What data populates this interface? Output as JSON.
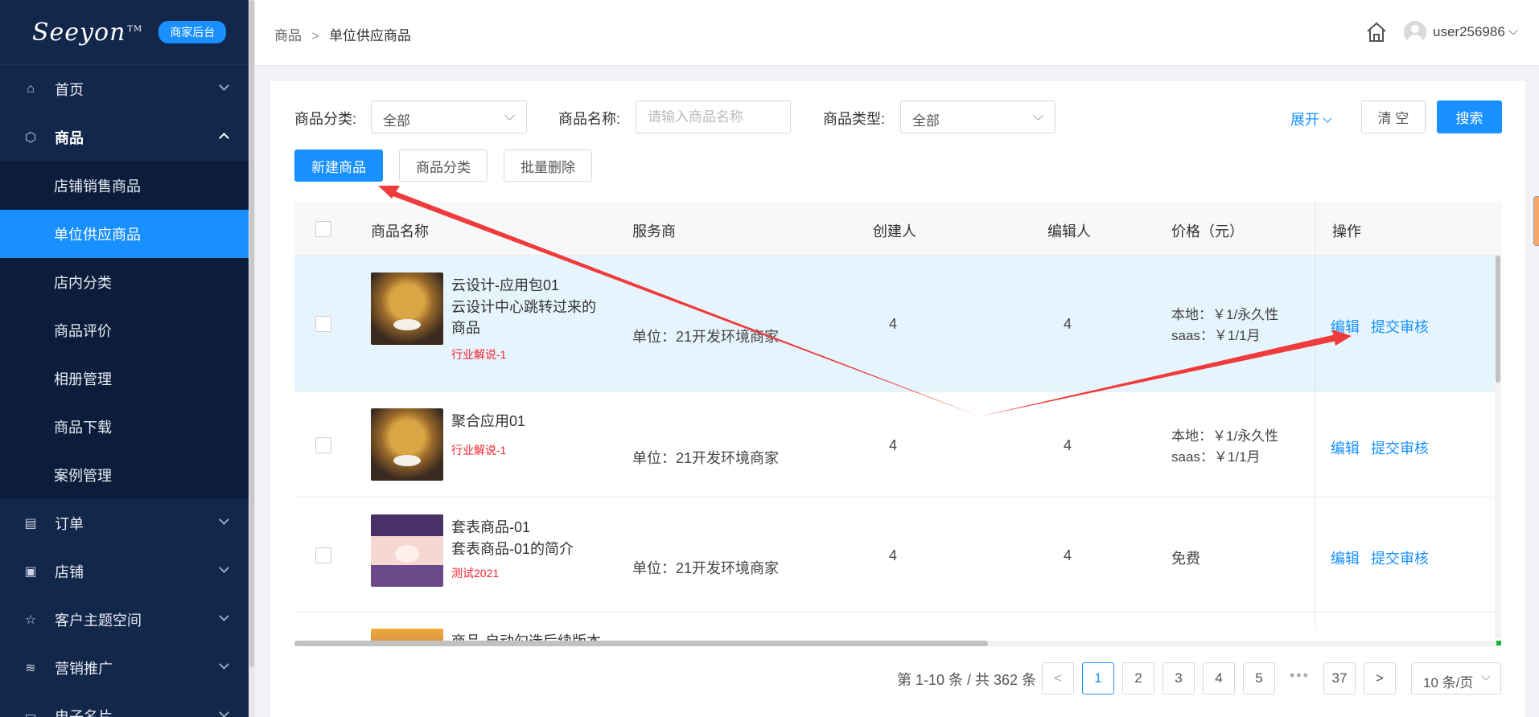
{
  "brand": {
    "logo_text": "Seeyon",
    "logo_tm": "TM",
    "badge": "商家后台"
  },
  "sidebar": {
    "items": [
      {
        "label": "首页",
        "icon": "home-icon"
      },
      {
        "label": "商品",
        "icon": "cube-icon"
      },
      {
        "label": "订单",
        "icon": "order-icon"
      },
      {
        "label": "店铺",
        "icon": "shop-icon"
      },
      {
        "label": "客户主题空间",
        "icon": "star-icon"
      },
      {
        "label": "营销推广",
        "icon": "layers-icon"
      },
      {
        "label": "电子名片",
        "icon": "card-icon"
      }
    ],
    "submenu": [
      "店铺销售商品",
      "单位供应商品",
      "店内分类",
      "商品评价",
      "相册管理",
      "商品下载",
      "案例管理"
    ]
  },
  "header": {
    "breadcrumb": [
      "商品",
      "单位供应商品"
    ],
    "breadcrumb_sep": ">",
    "username": "user256986"
  },
  "filters": {
    "category_label": "商品分类:",
    "category_value": "全部",
    "name_label": "商品名称:",
    "name_placeholder": "请输入商品名称",
    "type_label": "商品类型:",
    "type_value": "全部",
    "expand": "展开",
    "clear": "清 空",
    "search": "搜索"
  },
  "toolbar": {
    "new_product": "新建商品",
    "product_category": "商品分类",
    "batch_delete": "批量删除"
  },
  "table": {
    "columns": [
      "商品名称",
      "服务商",
      "创建人",
      "编辑人",
      "价格（元）",
      "操作"
    ],
    "rows": [
      {
        "name": "云设计-应用包01",
        "desc": "云设计中心跳转过来的商品",
        "tag": "行业解说-1",
        "provider": "单位：21开发环境商家",
        "creator": "4",
        "editor": "4",
        "price_local": "本地：￥1/永久性",
        "price_saas": "saas：￥1/1月",
        "edit": "编辑",
        "submit": "提交审核"
      },
      {
        "name": "聚合应用01",
        "desc": "",
        "tag": "行业解说-1",
        "provider": "单位：21开发环境商家",
        "creator": "4",
        "editor": "4",
        "price_local": "本地：￥1/永久性",
        "price_saas": "saas：￥1/1月",
        "edit": "编辑",
        "submit": "提交审核"
      },
      {
        "name": "套表商品-01",
        "desc": "套表商品-01的简介",
        "tag": "测试2021",
        "provider": "单位：21开发环境商家",
        "creator": "4",
        "editor": "4",
        "price_free": "免费",
        "edit": "编辑",
        "submit": "提交审核"
      },
      {
        "name": "商品-自动勾选后续版本"
      }
    ]
  },
  "pagination": {
    "total": "第 1-10 条 / 共 362 条",
    "pages": [
      "1",
      "2",
      "3",
      "4",
      "5"
    ],
    "ellipsis": "•••",
    "last": "37",
    "prev": "<",
    "next": ">",
    "page_size": "10 条/页"
  },
  "colors": {
    "sidebar_bg": "#12274a",
    "accent": "#1890ff",
    "tag_red": "#f5222d",
    "annotation_arrow": "#ef3b3b"
  }
}
